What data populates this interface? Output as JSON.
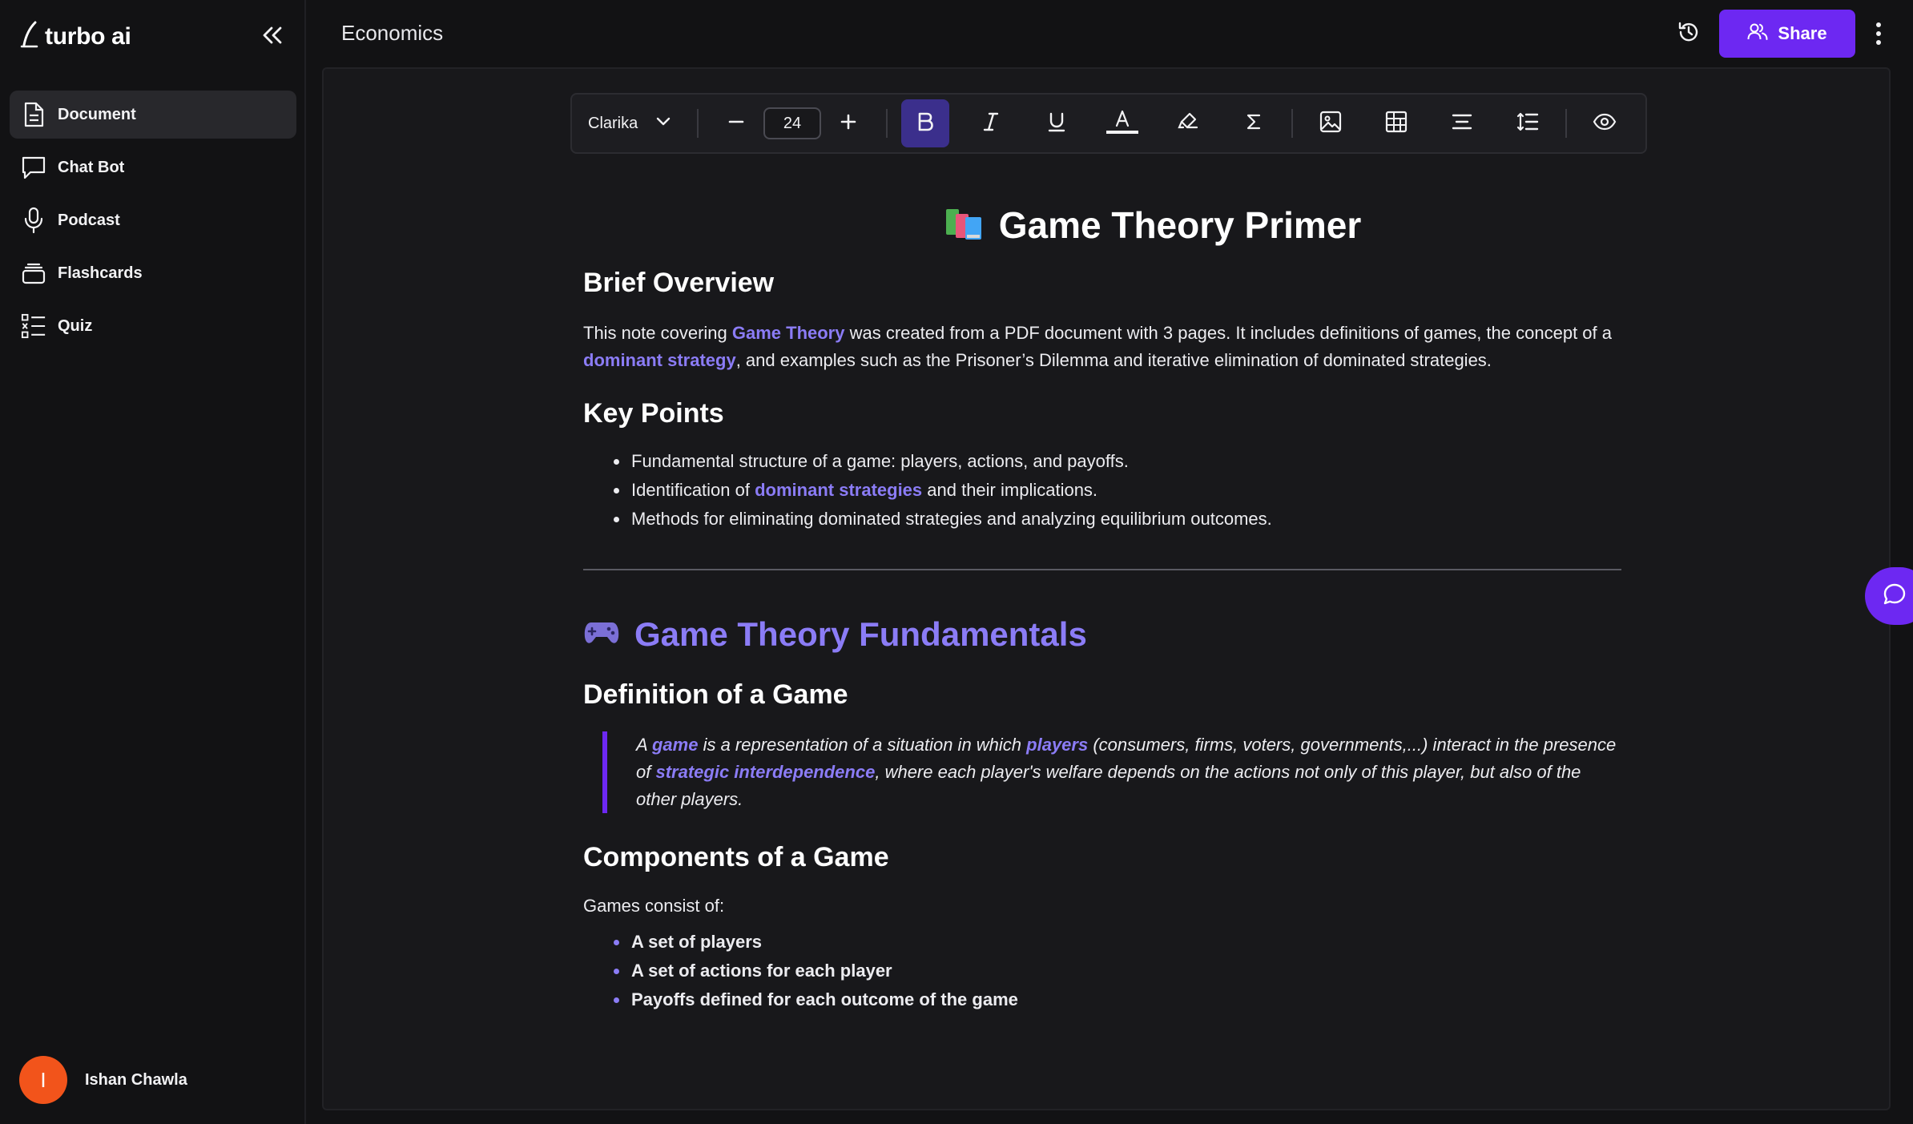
{
  "brand": {
    "name": "turbo ai"
  },
  "sidebar": {
    "items": [
      {
        "label": "Document",
        "icon": "document-icon",
        "active": true
      },
      {
        "label": "Chat Bot",
        "icon": "chat-bubble-icon",
        "active": false
      },
      {
        "label": "Podcast",
        "icon": "microphone-icon",
        "active": false
      },
      {
        "label": "Flashcards",
        "icon": "cards-stack-icon",
        "active": false
      },
      {
        "label": "Quiz",
        "icon": "quiz-list-icon",
        "active": false
      }
    ],
    "user": {
      "name": "Ishan Chawla",
      "initial": "I",
      "avatar_color": "#f2541b"
    }
  },
  "header": {
    "title": "Economics",
    "share_label": "Share"
  },
  "toolbar": {
    "font": "Clarika",
    "font_size": "24",
    "italic_glyph": "I",
    "underline_glyph": "U",
    "text_color_glyph": "A",
    "sigma_glyph": "Σ"
  },
  "document": {
    "title": "Game Theory Primer",
    "overview": {
      "heading": "Brief Overview",
      "t1": "This note covering ",
      "l1": "Game Theory",
      "t2": " was created from a PDF document with 3 pages. It includes definitions of games, the concept of a ",
      "l2": "dominant strategy",
      "t3": ", and examples such as the Prisoner’s Dilemma and iterative elimination of dominated strategies."
    },
    "key_points": {
      "heading": "Key Points",
      "p1": "Fundamental structure of a game: players, actions, and payoffs.",
      "p2a": "Identification of ",
      "p2link": "dominant strategies",
      "p2b": " and their implications.",
      "p3": "Methods for eliminating dominated strategies and analyzing equilibrium outcomes."
    },
    "fundamentals": {
      "heading": "Game Theory Fundamentals",
      "definition_heading": "Definition of a Game",
      "q1": "A ",
      "ql1": "game",
      "q2": " is a representation of a situation in which ",
      "ql2": "players",
      "q3": " (consumers, firms, voters, governments,...) interact in the presence of ",
      "ql3": "strategic interdependence",
      "q4": ", where each player's welfare depends on the actions not only of this player, but also of the other players.",
      "components_heading": "Components of a Game",
      "components_intro": "Games consist of:",
      "components": [
        "A set of players",
        "A set of actions for each player",
        "Payoffs defined for each outcome of the game"
      ]
    }
  },
  "colors": {
    "accent": "#6d28f2",
    "link": "#8b7cf6",
    "background": "#121214",
    "panel": "#18181b"
  }
}
